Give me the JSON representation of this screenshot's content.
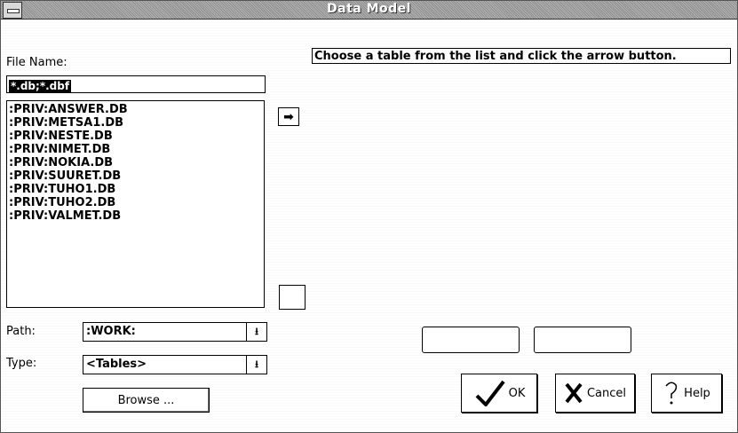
{
  "window": {
    "title": "Data Model"
  },
  "file_name": {
    "label": "File Name:",
    "value": "*.db;*.dbf"
  },
  "hint": "Choose a table from the list and click the arrow button.",
  "tables": [
    ":PRIV:ANSWER.DB",
    ":PRIV:METSA1.DB",
    ":PRIV:NESTE.DB",
    ":PRIV:NIMET.DB",
    ":PRIV:NOKIA.DB",
    ":PRIV:SUURET.DB",
    ":PRIV:TUHO1.DB",
    ":PRIV:TUHO2.DB",
    ":PRIV:VALMET.DB"
  ],
  "path": {
    "label": "Path:",
    "value": ":WORK:"
  },
  "type": {
    "label": "Type:",
    "value": "<Tables>"
  },
  "buttons": {
    "browse": "Browse ...",
    "ok": "OK",
    "cancel": "Cancel",
    "help": "Help"
  },
  "icons": {
    "arrow": "arrow-right-icon",
    "dropdown": "dropdown-arrow-icon",
    "ok": "checkmark-icon",
    "cancel": "x-mark-icon",
    "help": "question-mark-icon"
  }
}
